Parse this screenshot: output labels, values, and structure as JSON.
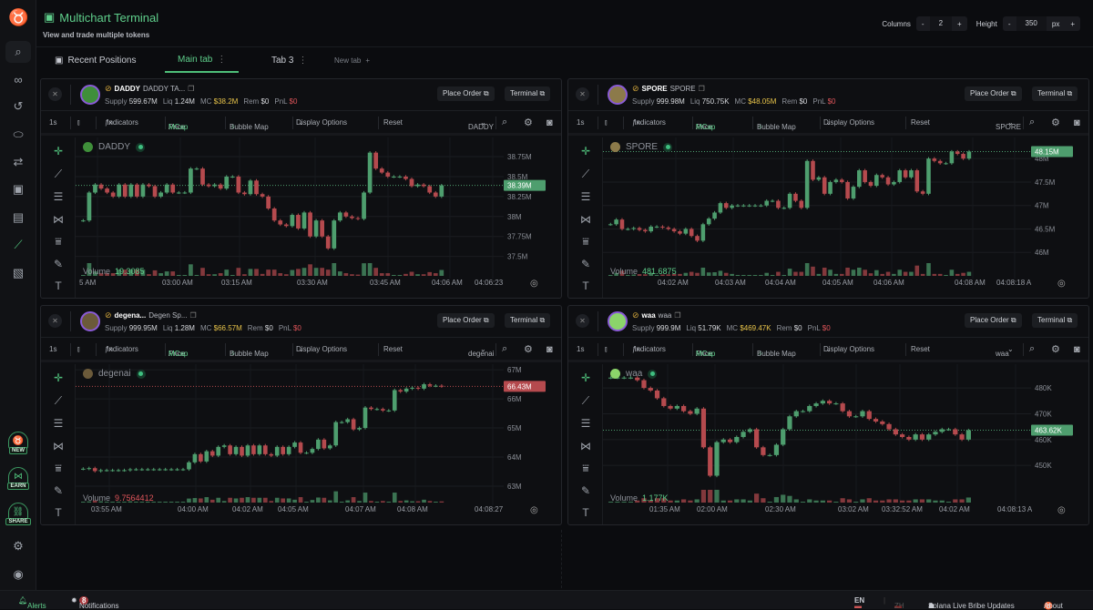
{
  "app": {
    "title": "Multichart Terminal",
    "subtitle": "View and trade multiple tokens"
  },
  "controls": {
    "columns_label": "Columns",
    "columns": "2",
    "height_label": "Height",
    "height": "350",
    "unit": "px",
    "minus": "-",
    "plus": "+"
  },
  "tabs": [
    {
      "label": "Recent Positions"
    },
    {
      "label": "Main tab",
      "active": true
    },
    {
      "label": "Tab 3"
    },
    {
      "label": "New tab"
    }
  ],
  "sidebar": {
    "badges": [
      "NEW",
      "EARN",
      "SHARE"
    ]
  },
  "toolbar": {
    "interval": "1s",
    "indicators": "Indicators",
    "price": "Price",
    "slash": " / ",
    "mcap": "MCap",
    "bubble": "Bubble Map",
    "display": "Display Options",
    "reset": "Reset",
    "place_order": "Place Order",
    "terminal": "Terminal",
    "volume_label": "Volume"
  },
  "colors": {
    "up": "#4e9e6e",
    "down": "#b54a4e",
    "accent": "#5fcf8b"
  },
  "panels": [
    {
      "symbol": "DADDY",
      "name": "DADDY TA...",
      "supply": "599.67M",
      "liq": "1.24M",
      "mc": "$38.2M",
      "rem": "$0",
      "pnl": "$0",
      "legend": "DADDY",
      "select": "DADDY",
      "volume": "19.3085",
      "volume_color": "#5fcf8b",
      "last": "38.39M",
      "last_color": "#4e9e6e",
      "yticks": [
        "38.75M",
        "38.5M",
        "38.25M",
        "38M",
        "37.75M",
        "37.5M"
      ],
      "ytick_values": [
        38.75,
        38.5,
        38.25,
        38,
        37.75,
        37.5
      ],
      "ylim": [
        37.45,
        38.99
      ],
      "times": [
        "5 AM",
        "03:00 AM",
        "03:15 AM",
        "03:30 AM",
        "03:45 AM",
        "04:06 AM",
        "04:06:23"
      ],
      "closes": [
        37.95,
        38.3,
        38.4,
        38.35,
        38.3,
        38.25,
        38.4,
        38.25,
        38.4,
        38.25,
        38.4,
        38.38,
        38.25,
        38.3,
        38.4,
        38.3,
        38.3,
        38.3,
        38.6,
        38.6,
        38.4,
        38.38,
        38.4,
        38.35,
        38.5,
        38.5,
        38.3,
        38.28,
        38.45,
        38.28,
        38.25,
        38.1,
        37.95,
        37.9,
        37.88,
        38.02,
        37.85,
        38.05,
        37.75,
        37.95,
        37.75,
        37.6,
        37.95,
        38.05,
        38.0,
        37.98,
        37.97,
        38.3,
        38.8,
        38.6,
        38.55,
        38.5,
        38.5,
        38.5,
        38.47,
        38.38,
        38.4,
        38.38,
        38.3,
        38.25,
        38.39
      ]
    },
    {
      "symbol": "SPORE",
      "name": "SPORE",
      "supply": "999.98M",
      "liq": "750.75K",
      "mc": "$48.05M",
      "rem": "$0",
      "pnl": "$0",
      "legend": "SPORE",
      "select": "SPORE",
      "volume": "481.6875",
      "volume_color": "#5fcf8b",
      "last": "48.15M",
      "last_color": "#4e9e6e",
      "yticks": [
        "48M",
        "47.5M",
        "47M",
        "46.5M",
        "46M"
      ],
      "ytick_values": [
        48,
        47.5,
        47,
        46.5,
        46
      ],
      "ylim": [
        45.83,
        48.45
      ],
      "times": [
        "04:02 AM",
        "04:03 AM",
        "04:04 AM",
        "04:05 AM",
        "04:06 AM",
        "04:08 AM",
        "04:08:18 A"
      ],
      "closes": [
        46.6,
        46.7,
        46.5,
        46.5,
        46.52,
        46.48,
        46.45,
        46.55,
        46.55,
        46.53,
        46.5,
        46.45,
        46.4,
        46.5,
        46.35,
        46.25,
        46.6,
        46.72,
        46.85,
        47.05,
        46.95,
        47.0,
        47.0,
        47.0,
        47.0,
        47.0,
        47.0,
        47.1,
        47.1,
        46.95,
        46.95,
        47.25,
        47.1,
        46.95,
        47.95,
        47.55,
        47.6,
        47.25,
        47.5,
        47.55,
        47.5,
        47.15,
        47.4,
        47.75,
        47.5,
        47.42,
        47.65,
        47.6,
        47.45,
        47.5,
        47.75,
        47.6,
        47.75,
        47.3,
        47.25,
        48.0,
        47.95,
        47.9,
        47.9,
        48.15,
        48.1,
        48.0,
        48.15
      ]
    },
    {
      "symbol": "degena...",
      "name": "Degen Sp...",
      "supply": "999.95M",
      "liq": "1.28M",
      "mc": "$66.57M",
      "rem": "$0",
      "pnl": "$0",
      "legend": "degenai",
      "select": "degenai",
      "volume": "9.7564412",
      "volume_color": "#e0555a",
      "last": "66.43M",
      "last_color": "#b54a4e",
      "yticks": [
        "67M",
        "66M",
        "65M",
        "64M",
        "63M"
      ],
      "ytick_values": [
        67,
        66,
        65,
        64,
        63
      ],
      "ylim": [
        62.97,
        67.19
      ],
      "times": [
        "03:55 AM",
        "04:00 AM",
        "04:02 AM",
        "04:05 AM",
        "04:07 AM",
        "04:08 AM",
        "04:08:27"
      ],
      "closes": [
        63.6,
        63.62,
        63.52,
        63.55,
        63.55,
        63.55,
        63.55,
        63.55,
        63.58,
        63.58,
        63.58,
        63.58,
        63.58,
        63.58,
        63.58,
        63.58,
        63.58,
        63.58,
        63.82,
        64.1,
        63.85,
        64.2,
        64.05,
        64.35,
        64.4,
        64.1,
        64.35,
        64.05,
        64.4,
        64.1,
        64.4,
        64.1,
        64.05,
        64.35,
        64.1,
        64.35,
        64.5,
        64.15,
        64.15,
        64.28,
        64.6,
        64.3,
        64.4,
        65.2,
        65.2,
        65.3,
        64.95,
        65.0,
        65.7,
        65.65,
        65.65,
        65.6,
        65.6,
        66.3,
        66.25,
        66.35,
        66.38,
        66.35,
        66.5,
        66.45,
        66.45,
        66.43
      ]
    },
    {
      "symbol": "waa",
      "name": "waa",
      "supply": "999.9M",
      "liq": "51.79K",
      "mc": "$469.47K",
      "rem": "$0",
      "pnl": "$0",
      "legend": "waa",
      "select": "waa",
      "volume": "1.177K",
      "volume_color": "#5fcf8b",
      "last": "463.62K",
      "last_color": "#4e9e6e",
      "yticks": [
        "480K",
        "470K",
        "460K",
        "450K"
      ],
      "ytick_values": [
        480,
        470,
        460,
        450
      ],
      "ylim": [
        441.6,
        489.2
      ],
      "times": [
        "01:35 AM",
        "02:00 AM",
        "02:30 AM",
        "03:02 AM",
        "03:32:52 AM",
        "04:02 AM",
        "04:08:13 A"
      ],
      "closes": [
        484,
        484,
        484,
        484,
        483,
        480,
        479,
        476,
        473,
        472,
        473,
        471,
        470,
        472,
        457,
        446,
        459,
        460,
        459,
        461,
        463,
        464,
        457,
        454,
        454,
        458,
        464,
        469,
        471,
        471,
        473,
        474,
        475,
        474,
        474,
        471,
        469,
        469,
        471,
        468,
        467,
        466,
        464,
        462,
        461,
        460,
        462,
        460,
        462,
        463,
        464,
        464,
        462,
        460,
        463.62
      ]
    }
  ],
  "footer": {
    "alerts": "Alerts",
    "notifications": "Notifications",
    "notif_count": "8",
    "en": "EN",
    "zh": "ZH",
    "bribe": "Solana Live Bribe Updates",
    "about": "About"
  }
}
